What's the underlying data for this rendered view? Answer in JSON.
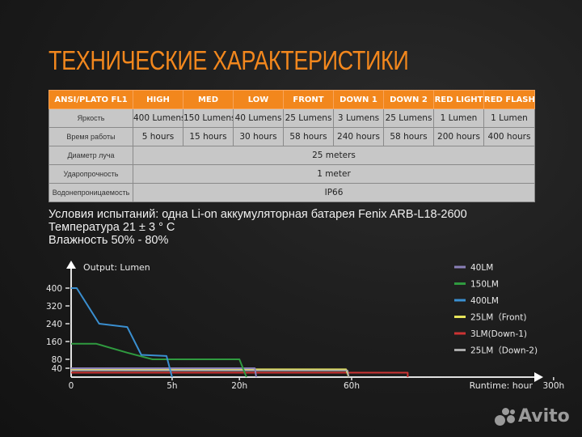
{
  "title": "ТЕХНИЧЕСКИЕ ХАРАКТЕРИСТИКИ",
  "table": {
    "header": [
      "ANSI/PLATO FL1",
      "HIGH",
      "MED",
      "LOW",
      "FRONT",
      "DOWN 1",
      "DOWN 2",
      "RED LIGHT",
      "RED FLASH"
    ],
    "brightness": {
      "label": "Яркость",
      "values": [
        "400 Lumens",
        "150 Lumens",
        "40 Lumens",
        "25 Lumens",
        "3 Lumens",
        "25 Lumens",
        "1 Lumen",
        "1 Lumen"
      ]
    },
    "runtime": {
      "label": "Время работы",
      "values": [
        "5 hours",
        "15 hours",
        "30 hours",
        "58 hours",
        "240 hours",
        "58 hours",
        "200 hours",
        "400 hours"
      ]
    },
    "beam": {
      "label": "Диаметр луча",
      "value": "25 meters"
    },
    "impact": {
      "label": "Ударопрочность",
      "value": "1 meter"
    },
    "water": {
      "label": "Водонепроницаемость",
      "value": "IP66"
    }
  },
  "conditions": [
    "Условия испытаний: одна Li-on аккумуляторная батарея Fenix ARB-L18-2600",
    "Температура 21 ± 3 ° C",
    "Влажность 50% - 80%"
  ],
  "chart_data": {
    "type": "line",
    "title": "",
    "ylabel": "Output: Lumen",
    "xlabel": "Runtime: hour",
    "y_ticks": [
      40,
      80,
      160,
      240,
      320,
      400
    ],
    "x_ticks": [
      "0",
      "5h",
      "20h",
      "60h",
      "300h"
    ],
    "x_axis_note": "non-linear time axis; positions follow tick labels",
    "ylim": [
      0,
      420
    ],
    "grid": false,
    "legend_position": "right",
    "series": [
      {
        "name": "40LM",
        "color": "#8a80b8",
        "points": [
          [
            0,
            40
          ],
          [
            0.655,
            40
          ],
          [
            0.66,
            0
          ]
        ]
      },
      {
        "name": "150LM",
        "color": "#2f9a3f",
        "points": [
          [
            0,
            150
          ],
          [
            0.09,
            150
          ],
          [
            0.2,
            110
          ],
          [
            0.29,
            80
          ],
          [
            0.6,
            80
          ],
          [
            0.625,
            0
          ]
        ]
      },
      {
        "name": "400LM",
        "color": "#3a8fd0",
        "points": [
          [
            0,
            400
          ],
          [
            0.02,
            400
          ],
          [
            0.1,
            240
          ],
          [
            0.2,
            225
          ],
          [
            0.25,
            100
          ],
          [
            0.34,
            95
          ],
          [
            0.36,
            0
          ]
        ]
      },
      {
        "name": "25LM（Front)",
        "color": "#e6e45a",
        "points": [
          [
            0,
            35
          ],
          [
            0.98,
            35
          ],
          [
            0.99,
            0
          ]
        ]
      },
      {
        "name": "3LM(Down-1)",
        "color": "#cc3333",
        "points": [
          [
            0,
            20
          ],
          [
            1.2,
            20
          ],
          [
            1.2,
            0
          ]
        ]
      },
      {
        "name": "25LM（Down-2)",
        "color": "#aaaaaa",
        "points": [
          [
            0,
            30
          ],
          [
            0.985,
            30
          ],
          [
            0.99,
            0
          ]
        ]
      }
    ],
    "x_tick_fraction": {
      "0": 0,
      "5h": 0.36,
      "20h": 0.6,
      "60h": 1.0,
      "300h": 1.72
    }
  },
  "watermark": "Avito"
}
